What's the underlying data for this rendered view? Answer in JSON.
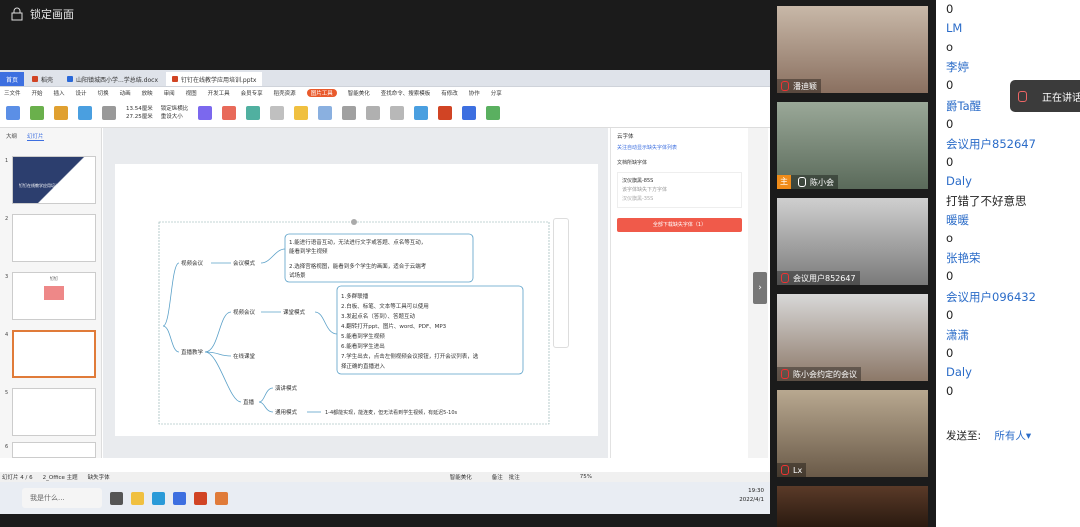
{
  "lock_bar": {
    "label": "锁定画面"
  },
  "tabs": [
    {
      "label": "首页"
    },
    {
      "label": "稻壳"
    },
    {
      "label": "山阳镇城西小学...学总结.docx"
    },
    {
      "label": "钉钉在线教学应用培训.pptx"
    }
  ],
  "menu": [
    "三文件",
    "开始",
    "插入",
    "设计",
    "切换",
    "动画",
    "放映",
    "审阅",
    "视图",
    "开发工具",
    "会员专享",
    "稻壳资源",
    "图片工具",
    "智能美化",
    "查找命令、搜索模板"
  ],
  "menu_active": "图片工具",
  "menu_right": [
    "有修改",
    "协作",
    "分享"
  ],
  "ribbon": {
    "items": [
      "插入图片",
      "替换图片",
      "压缩图片",
      "清晰化",
      "抠除背景",
      "图片设计",
      "图片拼接",
      "设置透明色",
      "颜色",
      "效果",
      "重设样式",
      "组合",
      "上移一层",
      "下移一层",
      "批量处理",
      "图片转PDF",
      "图片转文字",
      "图片翻译"
    ],
    "size_w": "13.54厘米",
    "size_h": "27.25厘米",
    "lock_ratio": "锁定纵横比",
    "reset_size": "重设大小"
  },
  "left_panel": {
    "tabs": [
      "大纲",
      "幻灯片"
    ],
    "active": "幻灯片",
    "slide_numbers": [
      "1",
      "2",
      "3",
      "4",
      "5",
      "6"
    ],
    "thumb1_title": "钉钉在线教学应用培训",
    "thumb3_title": "钉钉"
  },
  "slide": {
    "root": "直播教学",
    "branch_video": "视频会议",
    "branch_live": "直播教学",
    "video_mode": "会议模式",
    "video_text": [
      "1.能进行语音互动，无法进行文字或答题、点名等互动，",
      "能看到学生视频",
      "2.选择宫格视图，能看到多个学生的画面，适合于云端考",
      "试场景"
    ],
    "live_sub1": "视频会议",
    "live_sub1_mode": "课堂模式",
    "classroom_text": [
      "1.多群联播",
      "2.白板、标笔、文本等工具可以使用",
      "3.发起点名（答到）、答题互动",
      "4.翻转打开ppt、图片、word、PDF、MP3",
      "5.能看到学生视频",
      "6.能看到学生进出",
      "7.学生出去，点击左侧视频会议按钮，打开会议列表，选",
      "择正确的直播进入"
    ],
    "live_sub2": "在线课堂",
    "live_sub3": "直播",
    "live_sub3_mode1": "演讲模式",
    "live_sub3_mode2": "通用模式",
    "general_text": "1-4都能实现，能连麦，但无法看到学生视频，有延迟5-10s"
  },
  "right_panel": {
    "title": "云字体",
    "link": "关注自动显示缺失字体列表",
    "doc_label": "文档所缺字体",
    "font1": "汉仪旗黑-85S",
    "font1_note": "该字体缺失下方字体",
    "font2": "汉仪旗黑-35S",
    "button": "全部下载缺失字体（1）"
  },
  "status_bar": {
    "slide": "幻灯片 4 / 6",
    "theme": "2_Office 主题",
    "font": "缺失字体",
    "beautify": "智能美化",
    "notes": "备注",
    "comment": "批注",
    "zoom": "75%"
  },
  "taskbar": {
    "search": "我是什么...",
    "time": "19:30",
    "date": "2022/4/1"
  },
  "participants": [
    {
      "name": "潘迪颖",
      "host": false
    },
    {
      "name": "陈小会",
      "host": true
    },
    {
      "name": "会议用户852647",
      "host": false
    },
    {
      "name": "陈小会约定的会议",
      "host": false
    },
    {
      "name": "Lx",
      "host": false
    }
  ],
  "host_badge": "主",
  "chat": {
    "lines": [
      {
        "text": "0",
        "blue": false
      },
      {
        "text": "LM",
        "blue": true
      },
      {
        "text": "o",
        "blue": false
      },
      {
        "text": "李婷",
        "blue": true
      },
      {
        "text": "0",
        "blue": false
      },
      {
        "text": "爵Ta醒",
        "blue": true
      },
      {
        "text": "0",
        "blue": false
      },
      {
        "text": "会议用户852647",
        "blue": true
      },
      {
        "text": "0",
        "blue": false
      },
      {
        "text": "Daly",
        "blue": true
      },
      {
        "text": "打错了不好意思",
        "blue": false
      },
      {
        "text": "暖暖",
        "blue": true
      },
      {
        "text": "o",
        "blue": false
      },
      {
        "text": "张艳荣",
        "blue": true
      },
      {
        "text": "0",
        "blue": false
      },
      {
        "text": "会议用户096432",
        "blue": true
      },
      {
        "text": "0",
        "blue": false
      },
      {
        "text": "潇潇",
        "blue": true
      },
      {
        "text": "0",
        "blue": false
      },
      {
        "text": "Daly",
        "blue": true
      },
      {
        "text": "0",
        "blue": false
      }
    ],
    "send_label": "发送至:",
    "send_target": "所有人",
    "send_arrow": "▾"
  },
  "toast": {
    "text": "正在讲话"
  },
  "colors": {
    "accent": "#2b6cc8",
    "orange": "#e95a2c",
    "download_btn": "#f05a4a"
  }
}
